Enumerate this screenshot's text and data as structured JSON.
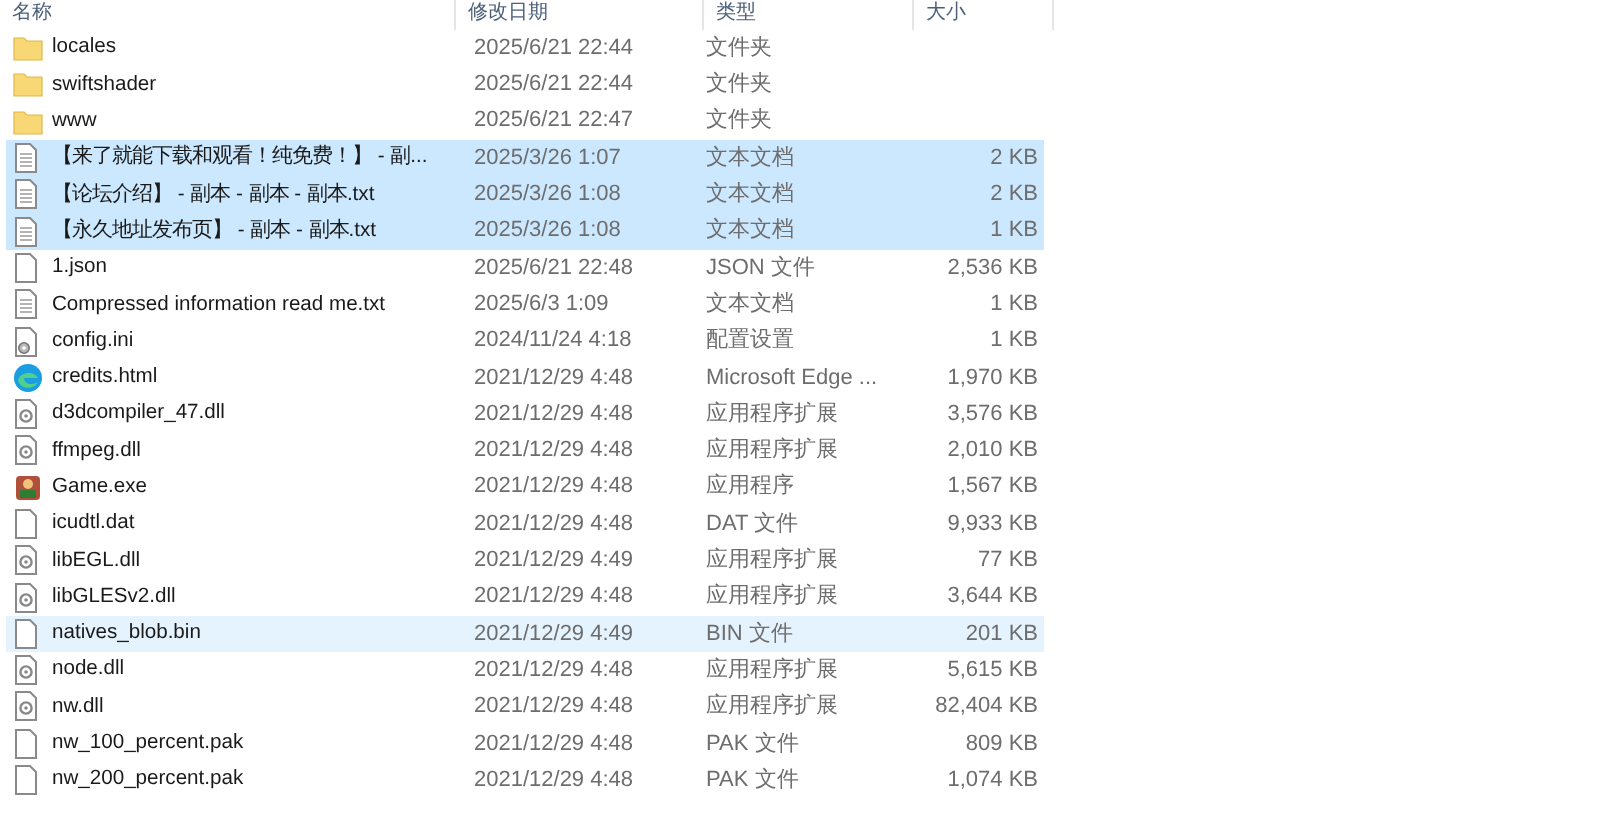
{
  "columns": [
    "名称",
    "修改日期",
    "类型",
    "大小"
  ],
  "rows": [
    {
      "kind": "folder",
      "name": "locales",
      "date": "2025/6/21 22:44",
      "type": "文件夹",
      "size": "",
      "selected": false,
      "hovered": false
    },
    {
      "kind": "folder",
      "name": "swiftshader",
      "date": "2025/6/21 22:44",
      "type": "文件夹",
      "size": "",
      "selected": false,
      "hovered": false
    },
    {
      "kind": "folder",
      "name": "www",
      "date": "2025/6/21 22:47",
      "type": "文件夹",
      "size": "",
      "selected": false,
      "hovered": false
    },
    {
      "kind": "text",
      "name": "【来了就能下载和观看！纯免费！】 - 副...",
      "date": "2025/3/26 1:07",
      "type": "文本文档",
      "size": "2 KB",
      "selected": true,
      "hovered": false
    },
    {
      "kind": "text",
      "name": "【论坛介绍】 - 副本 - 副本 - 副本.txt",
      "date": "2025/3/26 1:08",
      "type": "文本文档",
      "size": "2 KB",
      "selected": true,
      "hovered": false
    },
    {
      "kind": "text",
      "name": "【永久地址发布页】 - 副本 - 副本.txt",
      "date": "2025/3/26 1:08",
      "type": "文本文档",
      "size": "1 KB",
      "selected": true,
      "hovered": false
    },
    {
      "kind": "blank",
      "name": "1.json",
      "date": "2025/6/21 22:48",
      "type": "JSON 文件",
      "size": "2,536 KB",
      "selected": false,
      "hovered": false
    },
    {
      "kind": "text",
      "name": "Compressed information read me.txt",
      "date": "2025/6/3 1:09",
      "type": "文本文档",
      "size": "1 KB",
      "selected": false,
      "hovered": false
    },
    {
      "kind": "settings",
      "name": "config.ini",
      "date": "2024/11/24 4:18",
      "type": "配置设置",
      "size": "1 KB",
      "selected": false,
      "hovered": false
    },
    {
      "kind": "browser",
      "name": "credits.html",
      "date": "2021/12/29 4:48",
      "type": "Microsoft Edge ...",
      "size": "1,970 KB",
      "selected": false,
      "hovered": false
    },
    {
      "kind": "dll",
      "name": "d3dcompiler_47.dll",
      "date": "2021/12/29 4:48",
      "type": "应用程序扩展",
      "size": "3,576 KB",
      "selected": false,
      "hovered": false
    },
    {
      "kind": "dll",
      "name": "ffmpeg.dll",
      "date": "2021/12/29 4:48",
      "type": "应用程序扩展",
      "size": "2,010 KB",
      "selected": false,
      "hovered": false
    },
    {
      "kind": "exe",
      "name": "Game.exe",
      "date": "2021/12/29 4:48",
      "type": "应用程序",
      "size": "1,567 KB",
      "selected": false,
      "hovered": false
    },
    {
      "kind": "blank",
      "name": "icudtl.dat",
      "date": "2021/12/29 4:48",
      "type": "DAT 文件",
      "size": "9,933 KB",
      "selected": false,
      "hovered": false
    },
    {
      "kind": "dll",
      "name": "libEGL.dll",
      "date": "2021/12/29 4:49",
      "type": "应用程序扩展",
      "size": "77 KB",
      "selected": false,
      "hovered": false
    },
    {
      "kind": "dll",
      "name": "libGLESv2.dll",
      "date": "2021/12/29 4:48",
      "type": "应用程序扩展",
      "size": "3,644 KB",
      "selected": false,
      "hovered": false
    },
    {
      "kind": "blank",
      "name": "natives_blob.bin",
      "date": "2021/12/29 4:49",
      "type": "BIN 文件",
      "size": "201 KB",
      "selected": false,
      "hovered": true
    },
    {
      "kind": "dll",
      "name": "node.dll",
      "date": "2021/12/29 4:48",
      "type": "应用程序扩展",
      "size": "5,615 KB",
      "selected": false,
      "hovered": false
    },
    {
      "kind": "dll",
      "name": "nw.dll",
      "date": "2021/12/29 4:48",
      "type": "应用程序扩展",
      "size": "82,404 KB",
      "selected": false,
      "hovered": false
    },
    {
      "kind": "blank",
      "name": "nw_100_percent.pak",
      "date": "2021/12/29 4:48",
      "type": "PAK 文件",
      "size": "809 KB",
      "selected": false,
      "hovered": false
    },
    {
      "kind": "blank",
      "name": "nw_200_percent.pak",
      "date": "2021/12/29 4:48",
      "type": "PAK 文件",
      "size": "1,074 KB",
      "selected": false,
      "hovered": false
    }
  ]
}
